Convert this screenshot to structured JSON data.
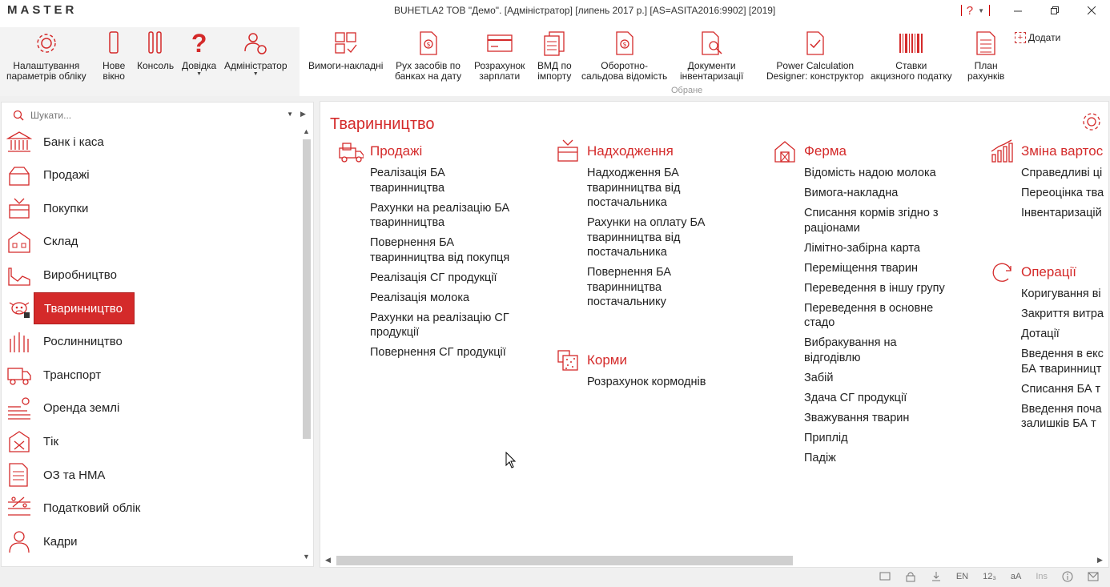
{
  "app": {
    "logo": "MASTER",
    "window_title": "BUHETLA2 ТОВ \"Демо\". [Адміністратор] [липень 2017 р.] [AS=ASITA2016:9902] [2019]"
  },
  "ribbon": {
    "left_buttons": [
      {
        "label": "Налаштування\nпараметрів обліку",
        "icon": "gear-icon"
      },
      {
        "label": "Нове\nвікно",
        "icon": "new-window-icon"
      },
      {
        "label": "Консоль",
        "icon": "console-icon"
      },
      {
        "label": "Довідка",
        "icon": "help-icon"
      },
      {
        "label": "Адміністратор",
        "icon": "admin-icon"
      }
    ],
    "favorites": [
      {
        "label": "Вимоги-накладні",
        "icon": "grid-check-icon"
      },
      {
        "label": "Рух засобів по\nбанках на дату",
        "icon": "money-doc-icon"
      },
      {
        "label": "Розрахунок\nзарплати",
        "icon": "card-icon"
      },
      {
        "label": "ВМД по\nімпорту",
        "icon": "docs-icon"
      },
      {
        "label": "Оборотно-\nсальдова відомість",
        "icon": "money-doc-icon"
      },
      {
        "label": "Документи\nінвентаризації",
        "icon": "search-doc-icon"
      },
      {
        "label": "Power Calculation\nDesigner: конструктор",
        "icon": "check-doc-icon"
      },
      {
        "label": "Ставки\nакцизного податку",
        "icon": "barcode-icon"
      },
      {
        "label": "План\nрахунків",
        "icon": "list-doc-icon"
      }
    ],
    "group_label": "Обране",
    "add_label": "Додати"
  },
  "sidebar": {
    "search_placeholder": "Шукати...",
    "items": [
      {
        "label": "Банк і каса",
        "icon": "bank-icon"
      },
      {
        "label": "Продажі",
        "icon": "box-icon"
      },
      {
        "label": "Покупки",
        "icon": "basket-icon"
      },
      {
        "label": "Склад",
        "icon": "warehouse-icon"
      },
      {
        "label": "Виробництво",
        "icon": "factory-icon"
      },
      {
        "label": "Тваринництво",
        "icon": "cow-icon",
        "active": true
      },
      {
        "label": "Рослинництво",
        "icon": "wheat-icon"
      },
      {
        "label": "Транспорт",
        "icon": "truck-icon"
      },
      {
        "label": "Оренда землі",
        "icon": "land-icon"
      },
      {
        "label": "Тік",
        "icon": "tik-icon"
      },
      {
        "label": "ОЗ та НМА",
        "icon": "assets-icon"
      },
      {
        "label": "Податковий облік",
        "icon": "tax-icon"
      },
      {
        "label": "Кадри",
        "icon": "person-icon"
      }
    ]
  },
  "main": {
    "title": "Тваринництво",
    "sections": [
      {
        "title": "Продажі",
        "icon": "sales-truck-icon",
        "links": [
          "Реалізація БА\nтваринництва",
          "Рахунки на реалізацію БА\nтваринництва",
          "Повернення БА\nтваринництва від покупця",
          "Реалізація СГ продукції",
          "Реалізація молока",
          "Рахунки на реалізацію СГ\nпродукції",
          "Повернення СГ продукції"
        ]
      },
      {
        "title": "Надходження",
        "icon": "incoming-box-icon",
        "links": [
          "Надходження БА\nтваринництва від\nпостачальника",
          "Рахунки на оплату БА\nтваринництва від\nпостачальника",
          "Повернення БА\nтваринництва\nпостачальнику"
        ]
      },
      {
        "title": "Корми",
        "icon": "feed-icon",
        "links": [
          "Розрахунок кормоднів"
        ]
      },
      {
        "title": "Ферма",
        "icon": "farm-icon",
        "links": [
          "Відомість надою молока",
          "Вимога-накладна",
          "Списання кормів згідно з\nраціонами",
          "Лімітно-забірна карта",
          "Переміщення тварин",
          "Переведення в іншу групу",
          "Переведення в основне\nстадо",
          "Вибракування на\nвідгодівлю",
          "Забій",
          "Здача СГ продукції",
          "Зважування тварин",
          "Приплід",
          "Падіж"
        ]
      },
      {
        "title": "Зміна вартос",
        "icon": "chart-icon",
        "links": [
          "Справедливі ці",
          "Переоцінка тва",
          "Інвентаризацій"
        ]
      },
      {
        "title": "Операції",
        "icon": "cycle-icon",
        "links": [
          "Коригування ві",
          "Закриття витра",
          "Дотації",
          "Введення в екс\nБА тваринницт",
          "Списання БА т",
          "Введення поча\nзалишків БА т"
        ]
      }
    ]
  },
  "statusbar": {
    "lang": "EN",
    "num": "12₃",
    "caps": "aA",
    "ins": "Ins"
  },
  "colors": {
    "accent": "#d42a2a",
    "text": "#222222",
    "background": "#f0f0f0"
  }
}
